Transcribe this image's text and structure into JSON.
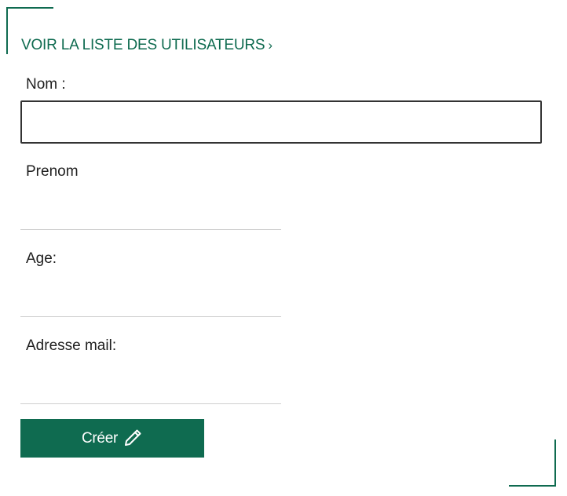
{
  "nav": {
    "back_link_label": "VOIR LA LISTE DES UTILISATEURS",
    "back_link_chevron": "›"
  },
  "form": {
    "nom": {
      "label": "Nom :",
      "value": ""
    },
    "prenom": {
      "label": "Prenom",
      "value": ""
    },
    "age": {
      "label": "Age:",
      "value": ""
    },
    "email": {
      "label": "Adresse mail:",
      "value": ""
    },
    "submit_label": "Créer",
    "submit_icon": "pencil-icon"
  },
  "colors": {
    "accent": "#0f6b50",
    "text": "#1f1f1f",
    "input_border": "#333333",
    "underline": "#cfcfcf"
  }
}
